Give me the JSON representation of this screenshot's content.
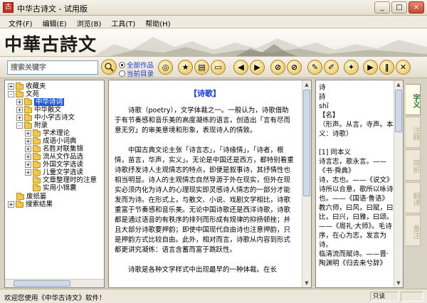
{
  "window": {
    "title": "中华古诗文 - 试用版",
    "icon_text": "古",
    "buttons": [
      "_",
      "□",
      "×"
    ]
  },
  "menu": [
    "文件(F)",
    "编辑(E)",
    "浏览(B)",
    "工具(T)",
    "帮助(H)"
  ],
  "banner": {
    "logo": "中華古詩文"
  },
  "toolbar": {
    "search_placeholder": "搜索关键字",
    "scope_all": "全部作品",
    "scope_current": "当前目录",
    "button_icons": [
      "home-icon",
      "star-icon",
      "book-icon",
      "folder-icon",
      "back-arrow-icon",
      "forward-arrow-icon",
      "stop-icon",
      "cancel-icon",
      "edit-icon",
      "note-icon",
      "bookmark-icon",
      "play-icon",
      "pause-icon",
      "close-icon"
    ],
    "button_glyphs": [
      "◎",
      "★",
      "▤",
      "▭",
      "◀",
      "▶",
      "⊘",
      "⊘",
      "✎",
      "✐",
      "✦",
      "▶",
      "‖",
      "✕"
    ]
  },
  "tree": {
    "items": [
      {
        "label": "收藏夹",
        "indent": 0,
        "expander": "+",
        "selected": false
      },
      {
        "label": "文苑",
        "indent": 0,
        "expander": "-",
        "selected": false
      },
      {
        "label": "中华诗词",
        "indent": 1,
        "expander": "+",
        "selected": true
      },
      {
        "label": "中华散文",
        "indent": 1,
        "expander": "+",
        "selected": false
      },
      {
        "label": "中小学古诗文",
        "indent": 1,
        "expander": "+",
        "selected": false
      },
      {
        "label": "附录",
        "indent": 1,
        "expander": "-",
        "selected": false
      },
      {
        "label": "学术理论",
        "indent": 2,
        "expander": "+",
        "selected": false
      },
      {
        "label": "成语小词典",
        "indent": 2,
        "expander": "+",
        "selected": false
      },
      {
        "label": "名胜对联集锦",
        "indent": 2,
        "expander": "+",
        "selected": false
      },
      {
        "label": "流从文作品选",
        "indent": 2,
        "expander": "+",
        "selected": false
      },
      {
        "label": "外国文学选读",
        "indent": 2,
        "expander": "+",
        "selected": false
      },
      {
        "label": "儿童文学选读",
        "indent": 2,
        "expander": "+",
        "selected": false
      },
      {
        "label": "文章整理时的注意",
        "indent": 2,
        "expander": "",
        "selected": false
      },
      {
        "label": "实用小锦囊",
        "indent": 2,
        "expander": "",
        "selected": false
      },
      {
        "label": "废纸篓",
        "indent": 0,
        "expander": "",
        "selected": false
      },
      {
        "label": "搜索结果",
        "indent": 0,
        "expander": "+",
        "selected": false
      }
    ]
  },
  "content": {
    "title": "【诗歌】",
    "paragraphs": [
      "诗歌（poetry），文学体裁之一。一般认为，诗歌借助于有节奏感和音乐美的高度凝练的语言，创造出「言有尽而意无穷」的审美意境和形象，表现诗人的情致。",
      "中国古典文论主张「诗言志」，「诗缘情」，「诗者，根情，苗言，华声，实义」。无论是中国还是西方，都特别看重诗歌抒发诗人主观情志的特点，即便是叙事诗，其抒情性也相当明显。诗人的主观情志自然导源于外在现实，但外在现实必须内化为诗人的心理现实即灵感诗人情志的一部分才能发而为诗。在形式上，与散文、小说、戏剧文学相比，诗歌重富于节奏感和音乐美。无论中国诗歌还是西洋诗歌，诗歌都是通过语音的有秩序的排列而形成有规律的抑扬顿挫；并且大部分诗歌要押韵；即使中国现代自由诗也注意押韵，只是押韵方式比较自由。此外，相对而言，诗歌从内容到形式都更讲究凝练：语言含蓄而富于跳跃性。",
      "诗歌是各种文学样式中出现最早的一种体裁。在长"
    ]
  },
  "dictionary": {
    "lines": [
      "诗",
      "詩",
      "shī",
      "【名】",
      "（形声。从言，寺声。本义：诗歌）",
      "",
      "[1] 同本义",
      "诗言志，歌永言。——《书·舜典》",
      "诗，志也。——《说文》",
      "诗所以合意，歌所以咏诗也。——《国语·鲁语》",
      "教六师，曰风，曰赋，曰比，曰兴，曰雅，曰颂。——《周礼·大师》。毛诗序，在心为志，发言为诗。",
      "临清流而赋诗。——晋·陶渊明《归去来兮辞》"
    ]
  },
  "side_tabs": [
    "字义",
    "注释",
    "简析",
    "翻译",
    "备注"
  ],
  "status": {
    "message": "欢迎您使用《中华古诗文》软件！",
    "mode": "只读"
  }
}
